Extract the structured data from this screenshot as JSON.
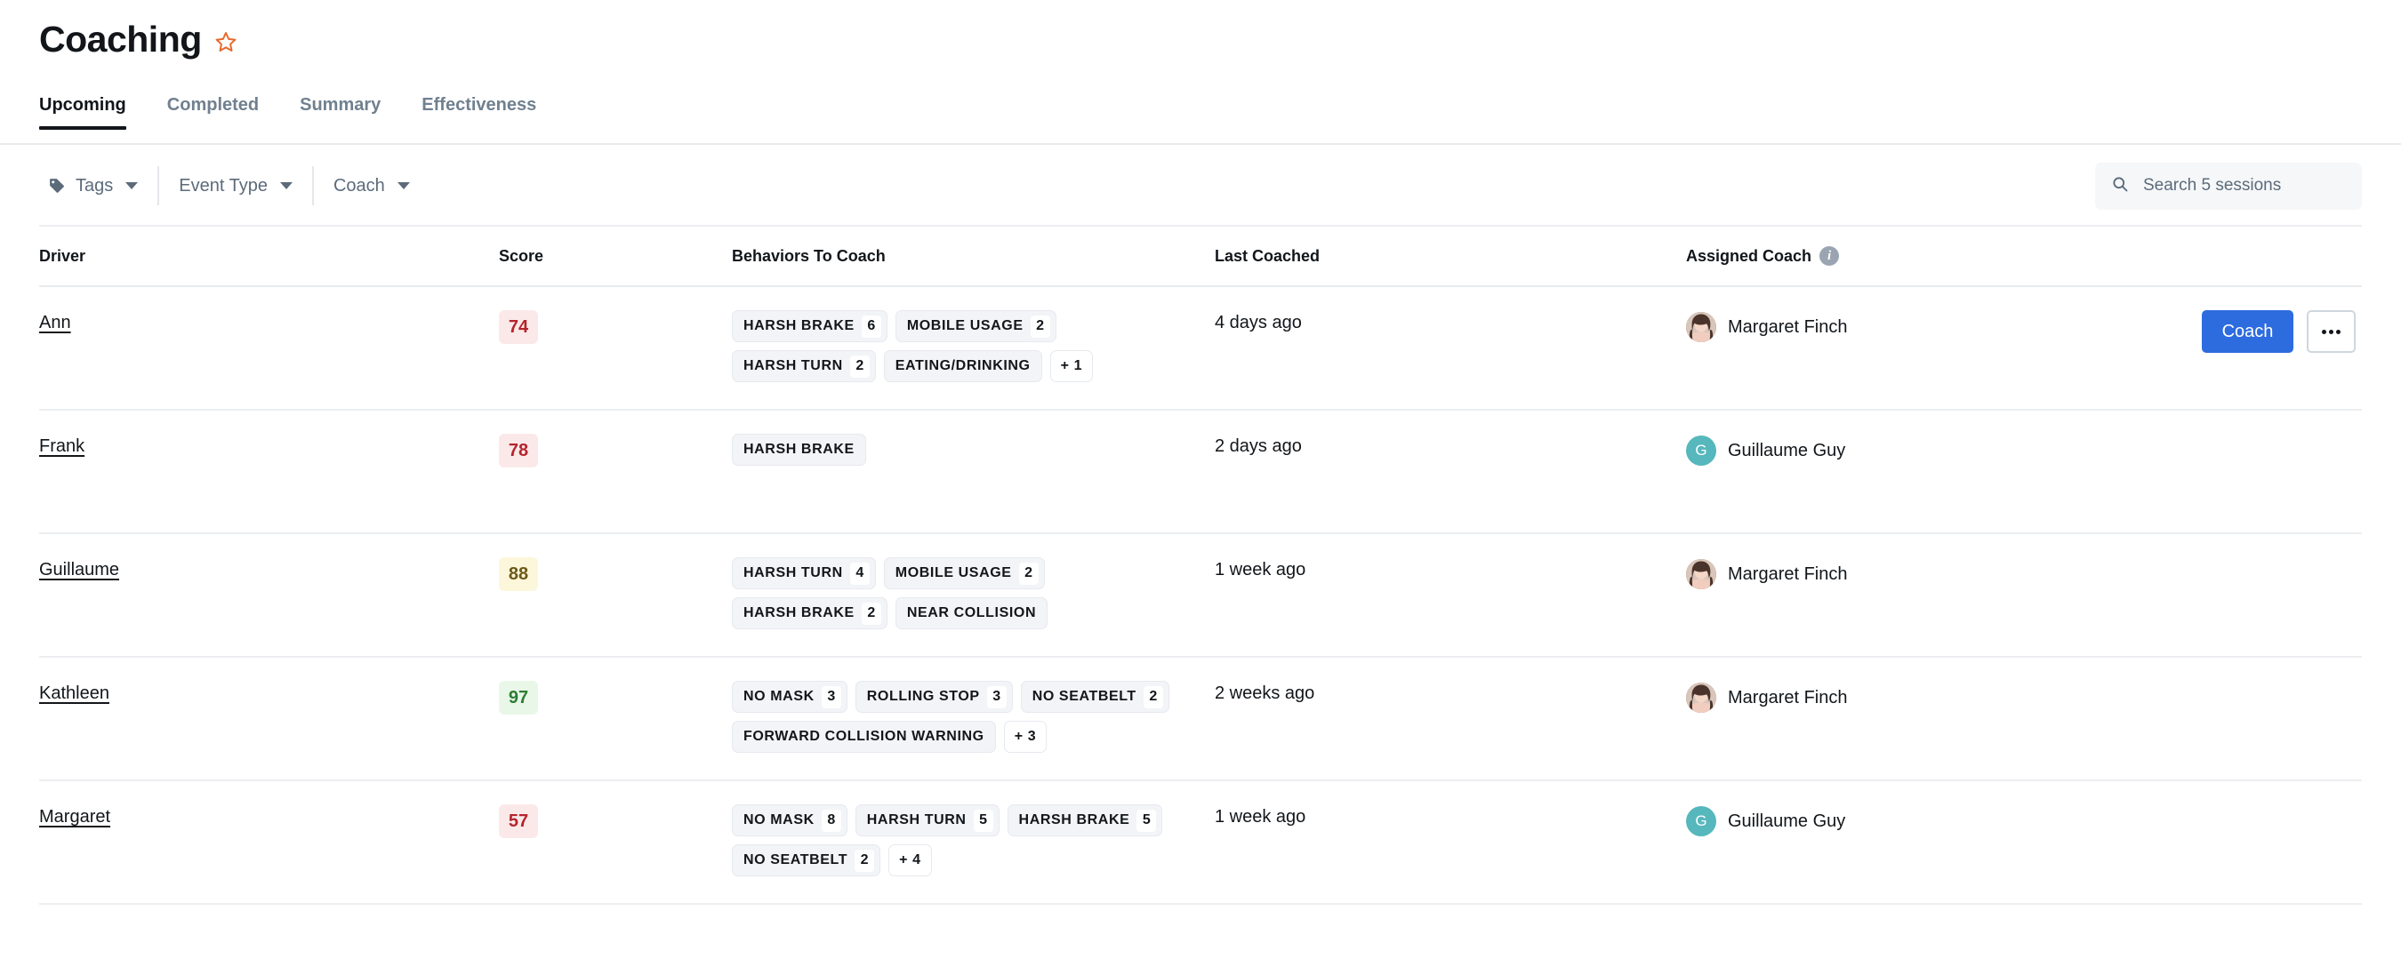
{
  "header": {
    "title": "Coaching",
    "favorite_icon": "star-outline-icon",
    "favorite_color": "#e8682c"
  },
  "tabs": [
    {
      "label": "Upcoming",
      "active": true
    },
    {
      "label": "Completed",
      "active": false
    },
    {
      "label": "Summary",
      "active": false
    },
    {
      "label": "Effectiveness",
      "active": false
    }
  ],
  "toolbar": {
    "filters": [
      {
        "label": "Tags",
        "icon": "tag-icon",
        "has_icon": true
      },
      {
        "label": "Event Type",
        "icon": "chevron-down-icon",
        "has_icon": false
      },
      {
        "label": "Coach",
        "icon": "chevron-down-icon",
        "has_icon": false
      }
    ],
    "search": {
      "placeholder": "Search 5 sessions",
      "value": "",
      "icon": "search-icon"
    }
  },
  "table": {
    "columns": [
      {
        "label": "Driver"
      },
      {
        "label": "Score"
      },
      {
        "label": "Behaviors To Coach"
      },
      {
        "label": "Last Coached"
      },
      {
        "label": "Assigned Coach",
        "info_icon": "info-icon"
      }
    ],
    "rows": [
      {
        "driver": "Ann",
        "score": "74",
        "score_bg": "#fbe9ea",
        "score_fg": "#b4242b",
        "behaviors": [
          {
            "label": "HARSH BRAKE",
            "count": "6"
          },
          {
            "label": "MOBILE USAGE",
            "count": "2"
          },
          {
            "label": "HARSH TURN",
            "count": "2"
          },
          {
            "label": "EATING/DRINKING",
            "count": ""
          }
        ],
        "more": "+ 1",
        "last_coached": "4 days ago",
        "coach": "Margaret Finch",
        "avatar_type": "photo",
        "avatar_initial": "M",
        "avatar_bg": "#6e4f45",
        "actions": {
          "visible": true,
          "coach_label": "Coach",
          "more_label": "more-options"
        }
      },
      {
        "driver": "Frank",
        "score": "78",
        "score_bg": "#fbe9ea",
        "score_fg": "#b4242b",
        "behaviors": [
          {
            "label": "HARSH BRAKE",
            "count": ""
          }
        ],
        "more": "",
        "last_coached": "2 days ago",
        "coach": "Guillaume Guy",
        "avatar_type": "initial",
        "avatar_initial": "G",
        "avatar_bg": "#56b7bd",
        "actions": {
          "visible": false,
          "coach_label": "Coach",
          "more_label": "more-options"
        }
      },
      {
        "driver": "Guillaume",
        "score": "88",
        "score_bg": "#fcf6db",
        "score_fg": "#6b5a16",
        "behaviors": [
          {
            "label": "HARSH TURN",
            "count": "4"
          },
          {
            "label": "MOBILE USAGE",
            "count": "2"
          },
          {
            "label": "HARSH BRAKE",
            "count": "2"
          },
          {
            "label": "NEAR COLLISION",
            "count": ""
          }
        ],
        "more": "",
        "last_coached": "1 week ago",
        "coach": "Margaret Finch",
        "avatar_type": "photo",
        "avatar_initial": "M",
        "avatar_bg": "#6e4f45",
        "actions": {
          "visible": false,
          "coach_label": "Coach",
          "more_label": "more-options"
        }
      },
      {
        "driver": "Kathleen",
        "score": "97",
        "score_bg": "#e9f7e9",
        "score_fg": "#2e7d32",
        "behaviors": [
          {
            "label": "NO MASK",
            "count": "3"
          },
          {
            "label": "ROLLING STOP",
            "count": "3"
          },
          {
            "label": "NO SEATBELT",
            "count": "2"
          },
          {
            "label": "FORWARD COLLISION WARNING",
            "count": ""
          }
        ],
        "more": "+ 3",
        "last_coached": "2 weeks ago",
        "coach": "Margaret Finch",
        "avatar_type": "photo",
        "avatar_initial": "M",
        "avatar_bg": "#6e4f45",
        "actions": {
          "visible": false,
          "coach_label": "Coach",
          "more_label": "more-options"
        }
      },
      {
        "driver": "Margaret",
        "score": "57",
        "score_bg": "#fbe9ea",
        "score_fg": "#b4242b",
        "behaviors": [
          {
            "label": "NO MASK",
            "count": "8"
          },
          {
            "label": "HARSH TURN",
            "count": "5"
          },
          {
            "label": "HARSH BRAKE",
            "count": "5"
          },
          {
            "label": "NO SEATBELT",
            "count": "2"
          }
        ],
        "more": "+ 4",
        "last_coached": "1 week ago",
        "coach": "Guillaume Guy",
        "avatar_type": "initial",
        "avatar_initial": "G",
        "avatar_bg": "#56b7bd",
        "actions": {
          "visible": false,
          "coach_label": "Coach",
          "more_label": "more-options"
        }
      }
    ]
  }
}
